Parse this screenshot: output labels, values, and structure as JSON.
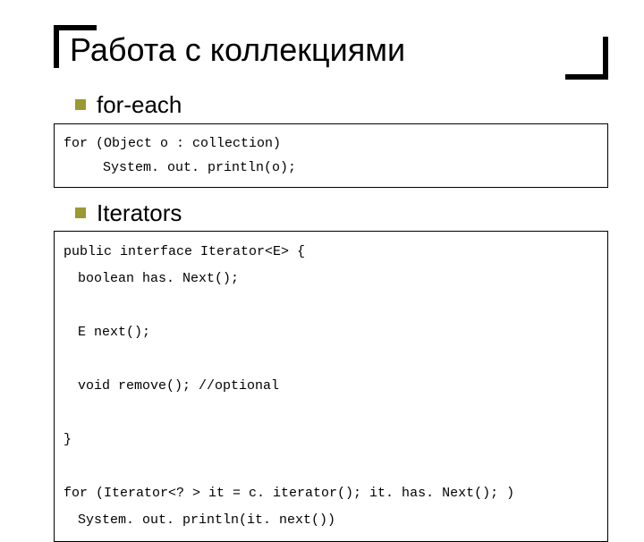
{
  "title": "Работа с коллекциями",
  "bullets": {
    "foreach": "for-each",
    "iterators": "Iterators"
  },
  "code": {
    "foreach": {
      "line1": "for (Object o : collection)",
      "line2": "System. out. println(o);"
    },
    "iterator": {
      "l1": "public interface Iterator<E> {",
      "l2": "boolean has. Next();",
      "l3": "E next();",
      "l4": "void remove(); //optional",
      "l5": "}",
      "l6": "",
      "l7": "for (Iterator<? > it = c. iterator(); it. has. Next(); )",
      "l8": "System. out. println(it. next())"
    }
  }
}
